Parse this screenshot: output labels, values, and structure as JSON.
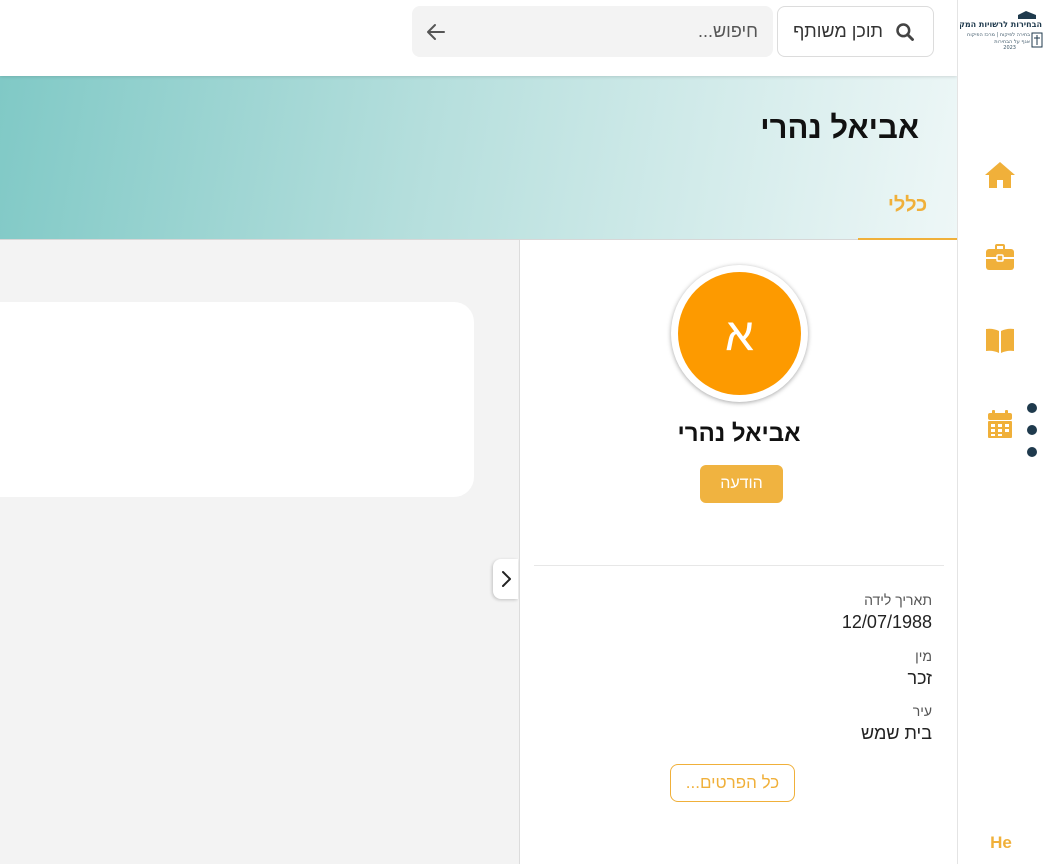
{
  "search": {
    "scope_label": "תוכן משותף",
    "placeholder": "חיפוש...",
    "value": ""
  },
  "header": {
    "title": "אביאל נהרי",
    "tabs": [
      {
        "label": "כללי",
        "active": true
      }
    ]
  },
  "profile": {
    "avatar_letter": "א",
    "avatar_color": "#fd9a00",
    "name": "אביאל נהרי",
    "message_button": "הודעה",
    "fields": [
      {
        "label": "תאריך לידה",
        "value": "12/07/1988"
      },
      {
        "label": "מין",
        "value": "זכר"
      },
      {
        "label": "עיר",
        "value": "בית שמש"
      }
    ],
    "all_details_button": "כל הפרטים..."
  },
  "sidebar": {
    "logo_line_1": "הבחירות לרשויות המקומיות",
    "logo_line_2": "בחירה לפיקוח | מרכז הפיקוח",
    "logo_line_3": "אגף על הבחירות",
    "logo_year": "2023",
    "items": [
      {
        "name": "home",
        "icon": "home-icon"
      },
      {
        "name": "work",
        "icon": "briefcase-icon"
      },
      {
        "name": "library",
        "icon": "book-icon"
      },
      {
        "name": "calendar",
        "icon": "calendar-icon"
      }
    ],
    "language": "He"
  },
  "colors": {
    "accent": "#f0b03a",
    "nav_dark": "#1f3a4d",
    "banner_start": "#80c9c6",
    "banner_end": "#eef7f7"
  }
}
